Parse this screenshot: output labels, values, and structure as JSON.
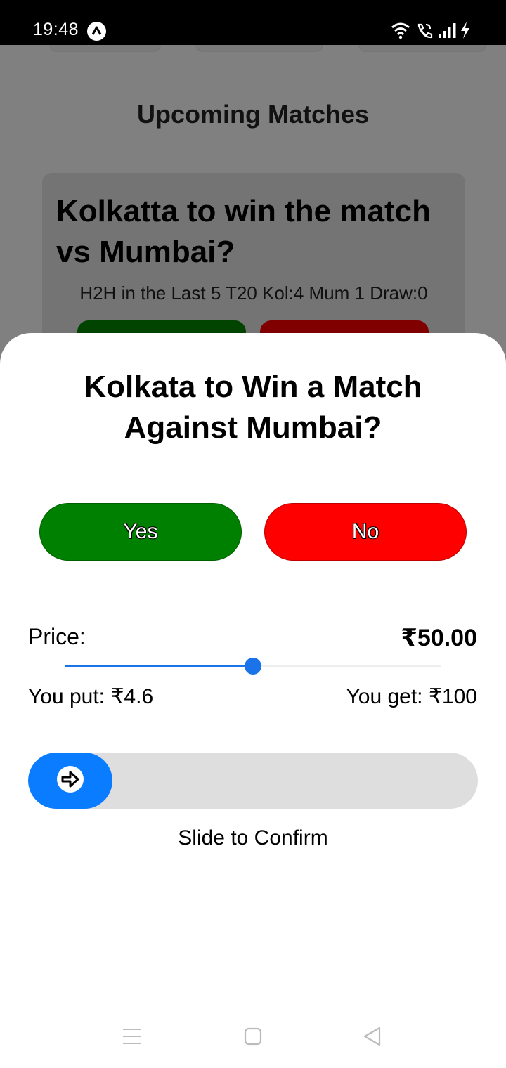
{
  "status_bar": {
    "time": "19:48"
  },
  "background": {
    "title": "Upcoming Matches",
    "card": {
      "question": "Kolkatta to win the match vs Mumbai?",
      "h2h": "H2H in the Last 5 T20 Kol:4 Mum 1 Draw:0"
    }
  },
  "sheet": {
    "title": "Kolkata to Win a Match Against Mumbai?",
    "yes_label": "Yes",
    "no_label": "No",
    "price_label": "Price:",
    "price_value": "₹50.00",
    "price_slider_fraction": 0.5,
    "you_put": "You put: ₹4.6",
    "you_get": "You get: ₹100",
    "slide_caption": "Slide to Confirm"
  },
  "colors": {
    "yes": "#008000",
    "no": "#ff0000",
    "accent": "#1a73e8",
    "slide_handle": "#0a7cff"
  },
  "icons": {
    "status_app": "a-logo-icon",
    "wifi": "wifi-icon",
    "call": "wifi-call-icon",
    "signal": "signal-icon",
    "battery": "charging-icon",
    "slide": "arrow-right-icon",
    "nav_menu": "menu-icon",
    "nav_home": "home-square-icon",
    "nav_back": "back-triangle-icon"
  }
}
